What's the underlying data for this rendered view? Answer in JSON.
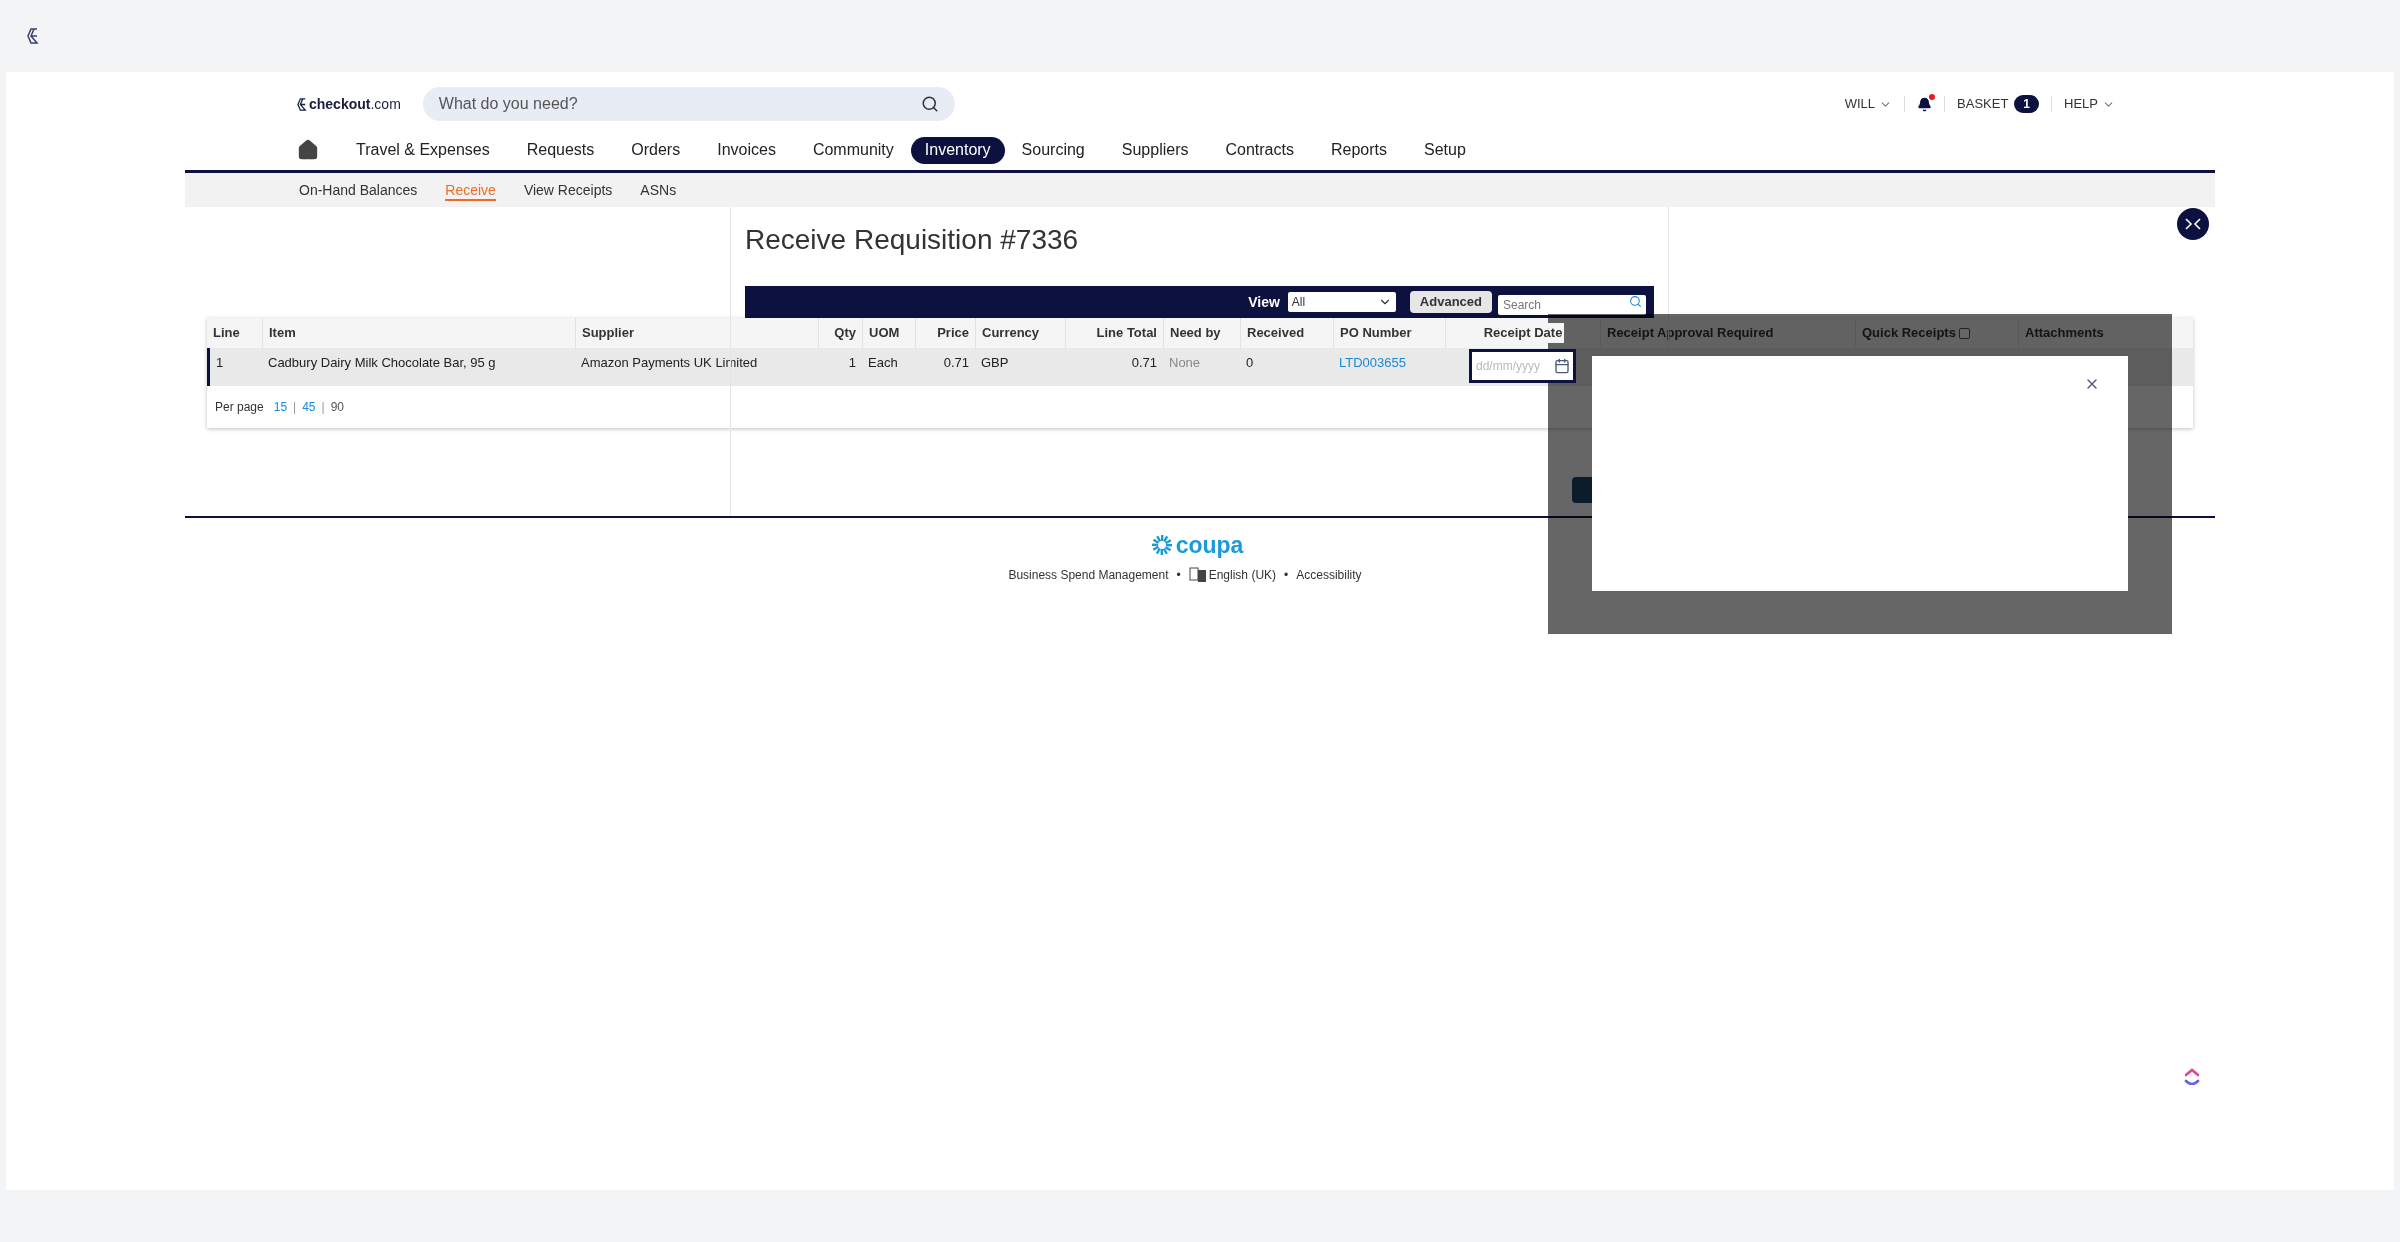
{
  "header": {
    "brand": "**checkout**.com",
    "search": {
      "placeholder": "What do you need?"
    },
    "user_menu": "WILL",
    "notifications": {
      "unread": true
    },
    "basket": {
      "label": "BASKET",
      "count": "1"
    },
    "help": "HELP"
  },
  "nav": [
    {
      "label": "Travel & Expenses",
      "selected": false
    },
    {
      "label": "Requests",
      "selected": false
    },
    {
      "label": "Orders",
      "selected": false
    },
    {
      "label": "Invoices",
      "selected": false
    },
    {
      "label": "Community",
      "selected": false
    },
    {
      "label": "Inventory",
      "selected": true
    },
    {
      "label": "Sourcing",
      "selected": false
    },
    {
      "label": "Suppliers",
      "selected": false
    },
    {
      "label": "Contracts",
      "selected": false
    },
    {
      "label": "Reports",
      "selected": false
    },
    {
      "label": "Setup",
      "selected": false
    }
  ],
  "subnav": [
    {
      "label": "On-Hand Balances",
      "selected": false
    },
    {
      "label": "Receive",
      "selected": true
    },
    {
      "label": "View Receipts",
      "selected": false
    },
    {
      "label": "ASNs",
      "selected": false
    }
  ],
  "page_title": "Receive Requisition #7336",
  "toolbar": {
    "view_label": "View",
    "view_value": "All",
    "advanced": "Advanced",
    "search_placeholder": "Search"
  },
  "table": {
    "columns": [
      "Line",
      "Item",
      "Supplier",
      "Qty",
      "UOM",
      "Price",
      "Currency",
      "Line Total",
      "Need by",
      "Received",
      "PO Number",
      "Receipt Date",
      "Receipt Approval Required",
      "Quick Receipts",
      "Attachments"
    ],
    "quick_receipts_checked": false,
    "rows": [
      {
        "line": "1",
        "item": "Cadbury Dairy Milk Chocolate Bar, 95 g",
        "supplier": "Amazon Payments UK Limited",
        "qty": "1",
        "uom": "Each",
        "price": "0.71",
        "currency": "GBP",
        "line_total": "0.71",
        "need_by": "None",
        "received": "0",
        "po_number": "LTD003655",
        "receipt_date_placeholder": "dd/mm/yyyy",
        "receipt_date_focused": true
      }
    ],
    "per_page_label": "Per page",
    "per_page_separator": "|",
    "per_page": [
      {
        "label": "15",
        "selected": false
      },
      {
        "label": "45",
        "selected": false
      },
      {
        "label": "90",
        "selected": true
      }
    ]
  },
  "footer": {
    "brand": "coupa",
    "links": [
      "Business Spend Management",
      "English (UK)",
      "Accessibility"
    ],
    "separator": "•"
  },
  "dialog": {
    "open": true
  }
}
